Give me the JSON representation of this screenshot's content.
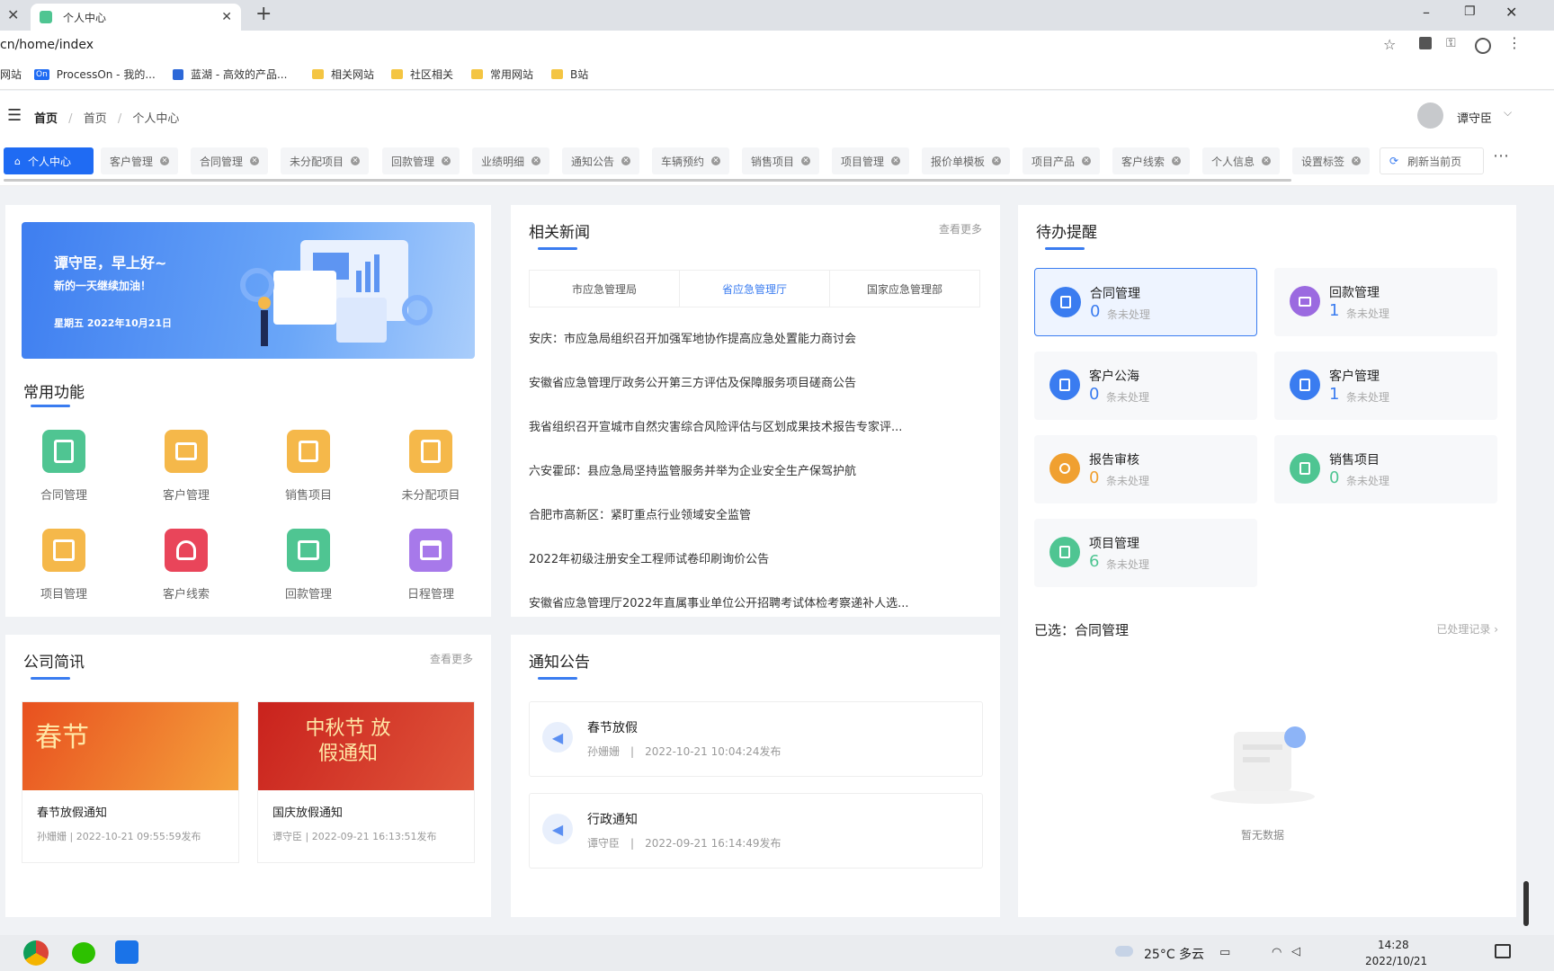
{
  "browser": {
    "tab_title": "个人中心",
    "address": "cn/home/index",
    "bookmarks": [
      "网站",
      "ProcessOn - 我的...",
      "蓝湖 - 高效的产品...",
      "相关网站",
      "社区相关",
      "常用网站",
      "B站"
    ]
  },
  "header": {
    "breadcrumb": [
      "首页",
      "首页",
      "个人中心"
    ],
    "user_name": "谭守臣"
  },
  "tags": [
    {
      "label": "个人中心",
      "active": true
    },
    {
      "label": "客户管理"
    },
    {
      "label": "合同管理"
    },
    {
      "label": "未分配项目"
    },
    {
      "label": "回款管理"
    },
    {
      "label": "业绩明细"
    },
    {
      "label": "通知公告"
    },
    {
      "label": "车辆预约"
    },
    {
      "label": "销售项目"
    },
    {
      "label": "项目管理"
    },
    {
      "label": "报价单模板"
    },
    {
      "label": "项目产品"
    },
    {
      "label": "客户线索"
    },
    {
      "label": "个人信息"
    },
    {
      "label": "设置标签"
    }
  ],
  "refresh_label": "刷新当前页",
  "banner": {
    "greeting": "谭守臣，早上好~",
    "sub": "新的一天继续加油！",
    "date": "星期五 2022年10月21日"
  },
  "functions": {
    "title": "常用功能",
    "items": [
      {
        "label": "合同管理",
        "color": "#4fc592"
      },
      {
        "label": "客户管理",
        "color": "#f5b84a"
      },
      {
        "label": "销售项目",
        "color": "#f5b84a"
      },
      {
        "label": "未分配项目",
        "color": "#f5b84a"
      },
      {
        "label": "项目管理",
        "color": "#f5b84a"
      },
      {
        "label": "客户线索",
        "color": "#e9455a"
      },
      {
        "label": "回款管理",
        "color": "#4fc592"
      },
      {
        "label": "日程管理",
        "color": "#a779ea"
      }
    ]
  },
  "news": {
    "title": "相关新闻",
    "more": "查看更多",
    "tabs": [
      "市应急管理局",
      "省应急管理厅",
      "国家应急管理部"
    ],
    "active_tab": 1,
    "items": [
      "安庆：市应急局组织召开加强军地协作提高应急处置能力商讨会",
      "安徽省应急管理厅政务公开第三方评估及保障服务项目磋商公告",
      "我省组织召开宣城市自然灾害综合风险评估与区划成果技术报告专家评...",
      "六安霍邱：县应急局坚持监管服务并举为企业安全生产保驾护航",
      "合肥市高新区：紧盯重点行业领域安全监管",
      "2022年初级注册安全工程师试卷印刷询价公告",
      "安徽省应急管理厅2022年直属事业单位公开招聘考试体检考察递补人选..."
    ]
  },
  "todo": {
    "title": "待办提醒",
    "unit": "条未处理",
    "items": [
      {
        "label": "合同管理",
        "count": "0",
        "color": "#3a7cf0",
        "selected": true
      },
      {
        "label": "回款管理",
        "count": "1",
        "color": "#9b6ae0"
      },
      {
        "label": "客户公海",
        "count": "0",
        "color": "#3a7cf0"
      },
      {
        "label": "客户管理",
        "count": "1",
        "color": "#3a7cf0"
      },
      {
        "label": "报告审核",
        "count": "0",
        "color": "#f0a030"
      },
      {
        "label": "销售项目",
        "count": "0",
        "color": "#4fc592"
      },
      {
        "label": "项目管理",
        "count": "6",
        "color": "#4fc592"
      }
    ],
    "selected_label": "已选：合同管理",
    "history_link": "已处理记录",
    "empty_text": "暂无数据"
  },
  "company": {
    "title": "公司简讯",
    "more": "查看更多",
    "items": [
      {
        "img_text": "春节",
        "title": "春节放假通知",
        "meta": "孙姗姗 | 2022-10-21 09:55:59发布"
      },
      {
        "img_text": "中秋节 放假通知",
        "title": "国庆放假通知",
        "meta": "谭守臣 | 2022-09-21 16:13:51发布"
      }
    ]
  },
  "notices": {
    "title": "通知公告",
    "items": [
      {
        "title": "春节放假",
        "author": "孙姗姗",
        "sep": "|",
        "time": "2022-10-21 10:04:24发布"
      },
      {
        "title": "行政通知",
        "author": "谭守臣",
        "sep": "|",
        "time": "2022-09-21 16:14:49发布"
      }
    ]
  },
  "taskbar": {
    "weather": "25°C 多云",
    "time": "14:28",
    "date": "2022/10/21"
  }
}
